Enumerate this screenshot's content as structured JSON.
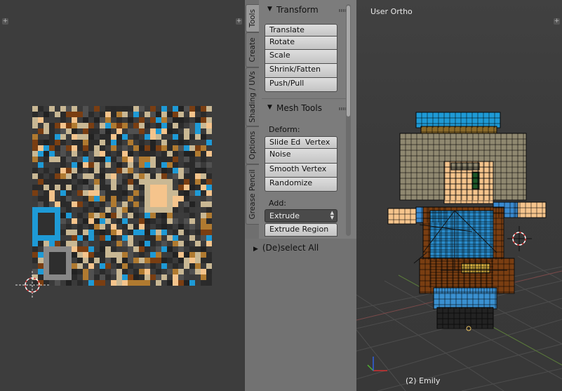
{
  "uv_editor": {
    "corner_left": "+",
    "corner_right": "+"
  },
  "tool_shelf": {
    "tabs": [
      "Tools",
      "Create",
      "Shading / UVs",
      "Options",
      "Grease Pencil"
    ],
    "active_tab": "Tools",
    "transform": {
      "title": "Transform",
      "buttons": [
        "Translate",
        "Rotate",
        "Scale",
        "Shrink/Fatten",
        "Push/Pull"
      ]
    },
    "mesh_tools": {
      "title": "Mesh Tools",
      "deform_label": "Deform:",
      "slide_edge": "Slide Ed",
      "vertex": "Vertex",
      "deform_buttons": [
        "Noise",
        "Smooth Vertex",
        "Randomize"
      ],
      "add_label": "Add:",
      "add_selected": "Extrude",
      "add_buttons": [
        "Extrude Region"
      ]
    },
    "operator_panel": {
      "title": "(De)select All"
    }
  },
  "viewport": {
    "view_label": "User Ortho",
    "object_label": "(2) Emily",
    "corner_right": "+"
  },
  "colors": {
    "uv_bg": "#3d3d3d",
    "shelf_bg": "#7c7c7c",
    "button_bg": "#d2d2d2",
    "accent_blue": "#1e9ad6",
    "brown": "#7a3e12",
    "tan": "#c9b894",
    "skin": "#f5c48c",
    "hair": "#8f8870"
  }
}
